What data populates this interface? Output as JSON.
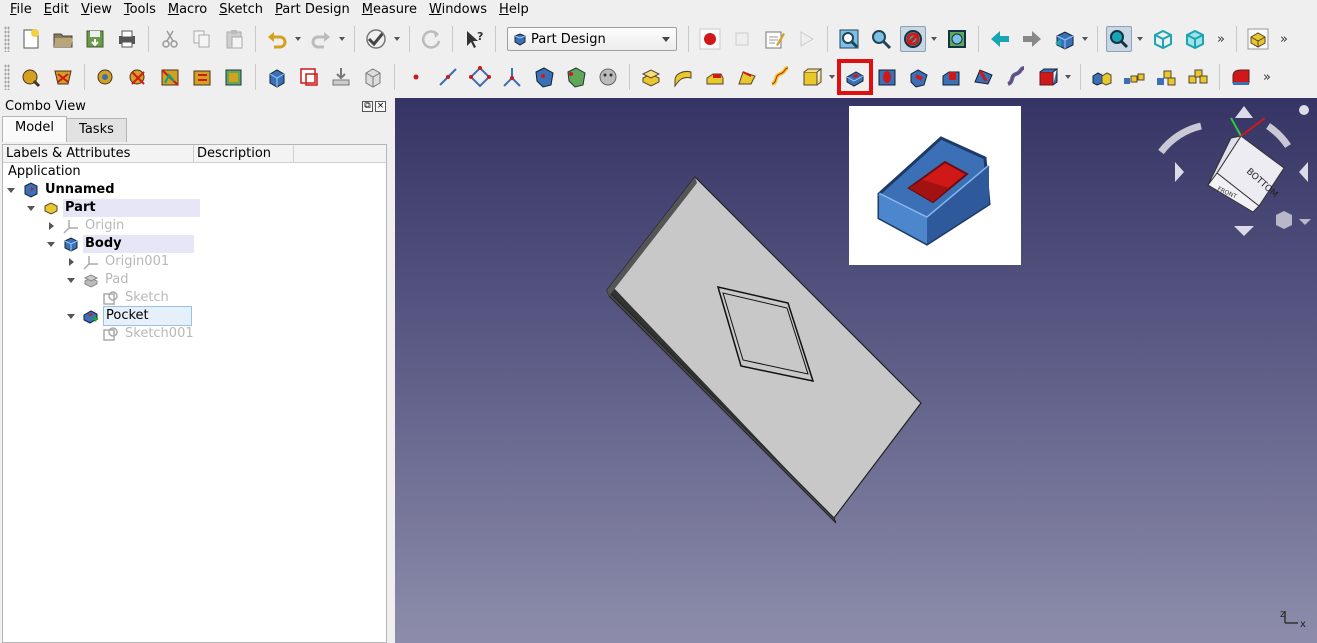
{
  "menu": [
    "File",
    "Edit",
    "View",
    "Tools",
    "Macro",
    "Sketch",
    "Part Design",
    "Measure",
    "Windows",
    "Help"
  ],
  "workbench": {
    "selected": "Part Design"
  },
  "toolbar1_icons": [
    "new-file-icon",
    "open-folder-icon",
    "save-icon",
    "print-icon",
    "cut-icon",
    "copy-icon",
    "paste-icon",
    "undo-icon",
    "redo-icon",
    "refresh-icon",
    "whats-this-icon",
    "record-macro-icon",
    "stop-macro-icon",
    "macro-editor-icon",
    "execute-macro-icon",
    "fit-all-icon",
    "fit-selection-icon",
    "draw-style-icon",
    "bounding-box-icon",
    "back-icon",
    "forward-icon",
    "std-views-icon",
    "zoom-icon",
    "isometric-icon",
    "view-front-icon",
    "part-icon"
  ],
  "toolbar2_icons": [
    "create-body-icon",
    "create-sketch-icon",
    "validate-sketch-icon",
    "check-geometry-icon",
    "attach-sketch-icon",
    "body-icon",
    "clone-icon",
    "subshape-binder-icon",
    "shape-binder-icon",
    "point-icon",
    "line-icon",
    "plane-icon",
    "coordinate-system-icon",
    "shape-binder-2-icon",
    "sub-shape-icon",
    "clone-2-icon",
    "pad-icon",
    "revolution-icon",
    "loft-icon",
    "sweep-icon",
    "helix-icon",
    "additive-primitive-icon",
    "pocket-icon",
    "hole-icon",
    "groove-icon",
    "subtractive-loft-icon",
    "subtractive-pipe-icon",
    "subtractive-helix-icon",
    "subtractive-primitive-icon",
    "mirrored-icon",
    "linear-pattern-icon",
    "polar-pattern-icon",
    "multitransform-icon",
    "fillet-icon"
  ],
  "highlight": {
    "tool": "pocket-icon",
    "color": "#e01010"
  },
  "combo": {
    "title": "Combo View",
    "tabs": [
      "Model",
      "Tasks"
    ],
    "columns": [
      "Labels & Attributes",
      "Description"
    ],
    "section": "Application",
    "tree": [
      {
        "label": "Unnamed",
        "icon": "document-icon",
        "bold": true
      },
      {
        "label": "Part",
        "icon": "part-icon",
        "bold": true
      },
      {
        "label": "Origin",
        "icon": "origin-icon",
        "greyed": true
      },
      {
        "label": "Body",
        "icon": "body-icon",
        "bold": true
      },
      {
        "label": "Origin001",
        "icon": "origin-icon",
        "greyed": true
      },
      {
        "label": "Pad",
        "icon": "pad-icon",
        "greyed": true
      },
      {
        "label": "Sketch",
        "icon": "sketch-icon",
        "greyed": true
      },
      {
        "label": "Pocket",
        "icon": "pocket-icon",
        "current": true
      },
      {
        "label": "Sketch001",
        "icon": "sketch-icon",
        "greyed": true
      }
    ]
  },
  "navcube": {
    "face": "BOTTOM",
    "back_face": "FRONT"
  },
  "axis_labels": {
    "x": "x",
    "z": "z"
  },
  "colors": {
    "accent": "#e01010",
    "viewport_top": "#353464",
    "viewport_bottom": "#8d8dab",
    "plate": "#c8c8c8"
  }
}
